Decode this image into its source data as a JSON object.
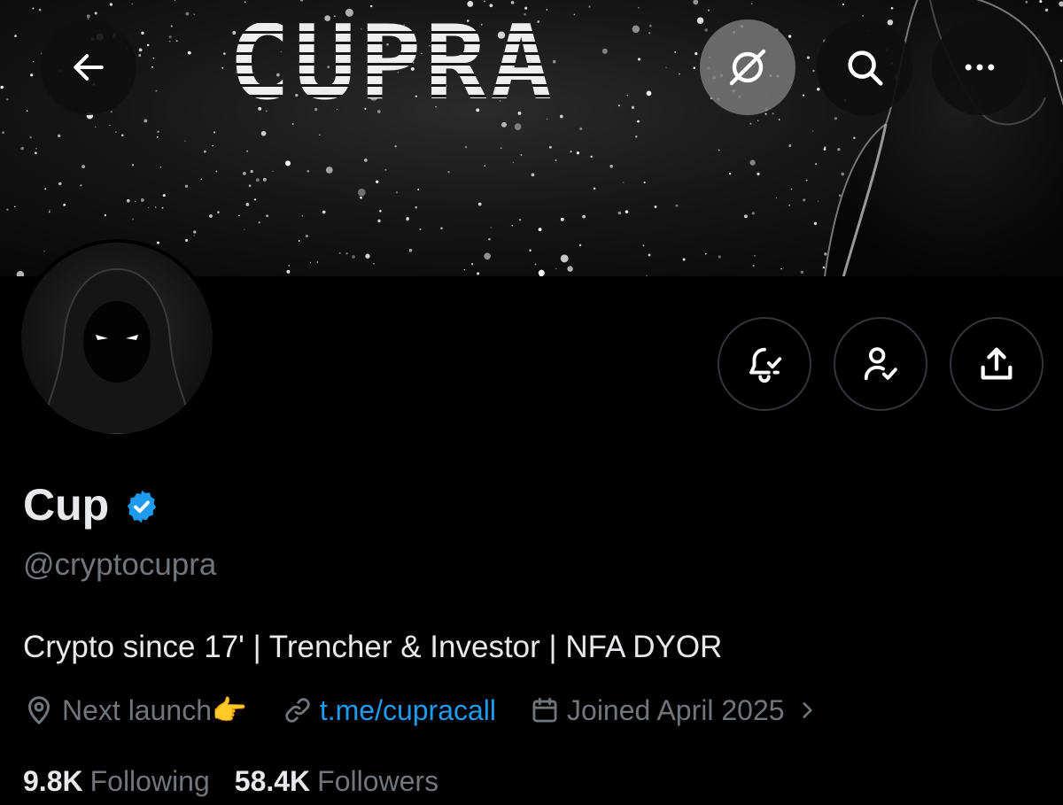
{
  "banner": {
    "title_text": "CUPRA"
  },
  "icons": {
    "back": "arrow-left-icon",
    "grok": "grok-icon",
    "search": "search-icon",
    "more": "more-horizontal-icon",
    "notifications": "bell-check-icon",
    "following": "person-check-icon",
    "share": "share-icon",
    "verified": "verified-badge-icon",
    "location": "location-pin-icon",
    "link": "link-icon",
    "calendar": "calendar-icon",
    "chevron": "chevron-right-icon"
  },
  "profile": {
    "display_name": "Cup",
    "handle": "@cryptocupra",
    "bio": "Crypto since 17' | Trencher & Investor | NFA DYOR",
    "location": "Next launch👉",
    "website": "t.me/cupracall",
    "joined": "Joined April 2025",
    "following_count": "9.8K",
    "following_label": "Following",
    "followers_count": "58.4K",
    "followers_label": "Followers"
  },
  "colors": {
    "background": "#000000",
    "text_primary": "#e7e9ea",
    "text_secondary": "#71767b",
    "link": "#1d9bf0",
    "verified": "#1d9bf0",
    "button_border": "#333639"
  }
}
